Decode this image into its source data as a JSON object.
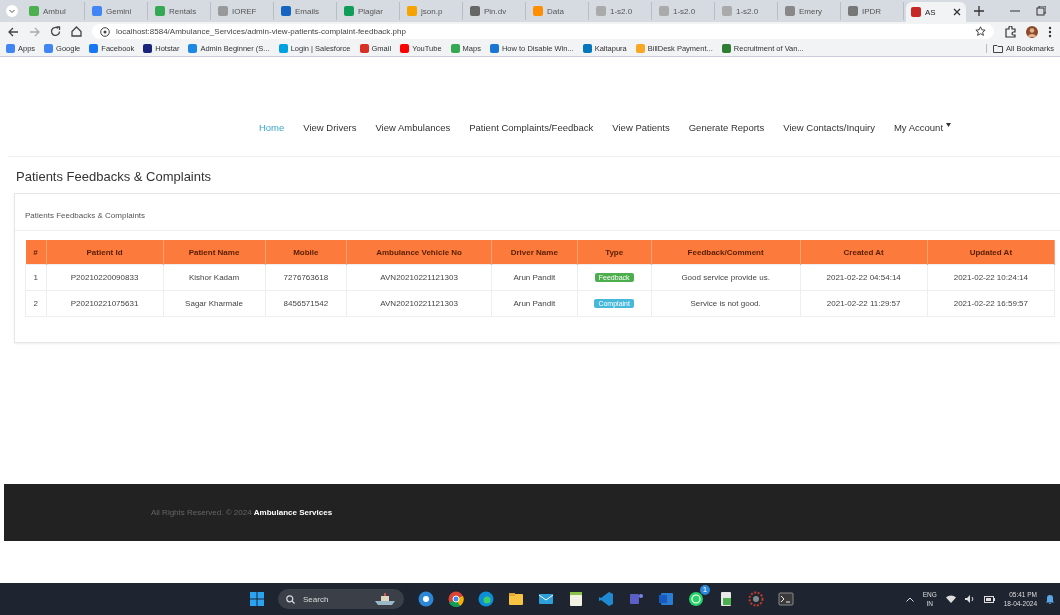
{
  "browser": {
    "tabs": [
      {
        "label": "Ambul",
        "selected": false
      },
      {
        "label": "Gemini",
        "selected": false
      },
      {
        "label": "Rentals",
        "selected": false
      },
      {
        "label": "IOREF",
        "selected": false
      },
      {
        "label": "Emails",
        "selected": false
      },
      {
        "label": "Plagiar",
        "selected": false
      },
      {
        "label": "json.p",
        "selected": false
      },
      {
        "label": "Pin.dv",
        "selected": false
      },
      {
        "label": "Data",
        "selected": false
      },
      {
        "label": "1-s2.0",
        "selected": false
      },
      {
        "label": "1-s2.0",
        "selected": false
      },
      {
        "label": "1-s2.0",
        "selected": false
      },
      {
        "label": "Emery",
        "selected": false
      },
      {
        "label": "IPDR",
        "selected": false
      },
      {
        "label": "AS",
        "selected": true
      }
    ],
    "url": "localhost:8584/Ambulance_Services/admin-view-patients-complaint-feedback.php",
    "bookmarks": [
      "Apps",
      "Google",
      "Facebook",
      "Hotstar",
      "Admin Beginner (S...",
      "Login | Salesforce",
      "Gmail",
      "YouTube",
      "Maps",
      "How to Disable Win...",
      "Kaltapura",
      "BillDesk Payment...",
      "Recruitment of Van..."
    ],
    "all_bookmarks": "All Bookmarks"
  },
  "nav": [
    {
      "label": "Home",
      "selected": true
    },
    {
      "label": "View Drivers",
      "selected": false
    },
    {
      "label": "View Ambulances",
      "selected": false
    },
    {
      "label": "Patient Complaints/Feedback",
      "selected": false
    },
    {
      "label": "View Patients",
      "selected": false
    },
    {
      "label": "Generate Reports",
      "selected": false
    },
    {
      "label": "View Contacts/Inquiry",
      "selected": false
    },
    {
      "label": "My Account",
      "selected": false,
      "dropdown": true
    }
  ],
  "page_title": "Patients Feedbacks & Complaints",
  "card": {
    "title": "Patients Feedbacks & Complaints",
    "table": {
      "columns": [
        "#",
        "Patient Id",
        "Patient Name",
        "Mobile",
        "Ambulance Vehicle No",
        "Driver Name",
        "Type",
        "Feedback/Comment",
        "Created At",
        "Updated At"
      ],
      "rows": [
        {
          "index": "1",
          "patient_id": "P20210220090833",
          "patient_name": "Kishor Kadam",
          "mobile": "7276763618",
          "vehicle_no": "AVN20210221121303",
          "driver_name": "Arun Pandit",
          "type": {
            "label": "Feedback",
            "kind": "feedback"
          },
          "comment": "Good service provide us.",
          "created_at": "2021-02-22 04:54:14",
          "updated_at": "2021-02-22 10:24:14"
        },
        {
          "index": "2",
          "patient_id": "P20210221075631",
          "patient_name": "Sagar Kharmale",
          "mobile": "8456571542",
          "vehicle_no": "AVN20210221121303",
          "driver_name": "Arun Pandit",
          "type": {
            "label": "Complaint",
            "kind": "complaint"
          },
          "comment": "Service is not good.",
          "created_at": "2021-02-22 11:29:57",
          "updated_at": "2021-02-22 16:59:57"
        }
      ]
    }
  },
  "footer": "All Rights Reserved. © 2024 **Ambulance Services**",
  "taskbar": {
    "search": "Search",
    "badge": "1",
    "language": "ENG",
    "region": "IN",
    "time": "05:41 PM",
    "date": "18-04-2024"
  }
}
